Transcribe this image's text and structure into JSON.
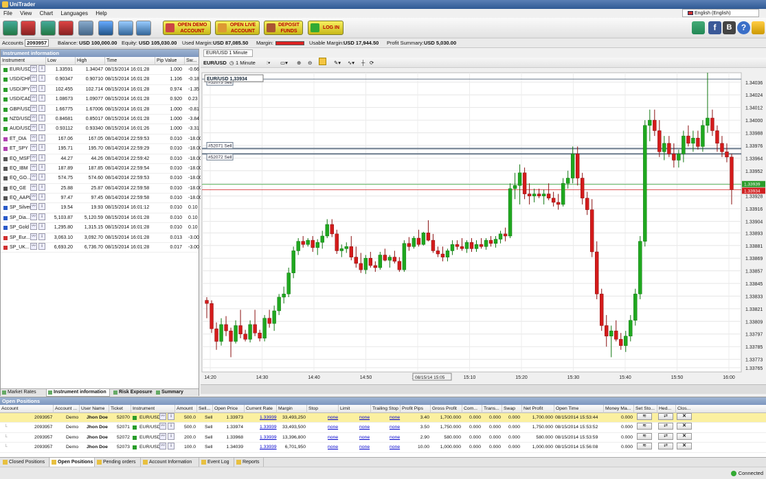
{
  "app": {
    "title": "UniTrader",
    "language": "English (English)"
  },
  "menu": [
    "File",
    "View",
    "Chart",
    "Languages",
    "Help"
  ],
  "toolbar": {
    "buttons": [
      {
        "icon": "buy-chart-icon"
      },
      {
        "icon": "sell-chart-icon"
      },
      {
        "icon": "buy-clock-icon"
      },
      {
        "icon": "sell-clock-icon"
      },
      {
        "icon": "cursor-icon"
      },
      {
        "icon": "currency-exchange-icon"
      },
      {
        "icon": "globe-icon"
      },
      {
        "icon": "settings-globe-icon"
      }
    ],
    "big_buttons": [
      {
        "line1": "OPEN DEMO",
        "line2": "ACCOUNT"
      },
      {
        "line1": "OPEN LIVE",
        "line2": "ACCOUNT"
      },
      {
        "line1": "DEPOSIT",
        "line2": "FUNDS"
      },
      {
        "line1": "LOG IN",
        "line2": ""
      }
    ],
    "right_icons": [
      "chart-icon",
      "facebook-icon",
      "blog-icon",
      "help-icon",
      "trader-icon"
    ]
  },
  "account": {
    "accounts_label": "Accounts",
    "account_id": "2093957",
    "balance_label": "Balance:",
    "balance": "USD 100,000.00",
    "equity_label": "Equity:",
    "equity": "USD 105,030.00",
    "used_margin_label": "Used Margin:",
    "used_margin": "USD 87,085.50",
    "margin_label": "Margin:",
    "usable_margin_label": "Usable Margin:",
    "usable_margin": "USD 17,944.50",
    "profit_label": "Profit Summary:",
    "profit": "USD 5,030.00"
  },
  "instrument_panel": {
    "title": "Instrument information",
    "columns": [
      "Instrument",
      "Low",
      "High",
      "Time",
      "Pip Value",
      "Sw..."
    ],
    "rows": [
      {
        "name": "EUR/USD",
        "low": "1.33591",
        "high": "1.34047",
        "time": "08/15/2014 16:01:28",
        "pip": "1.000",
        "sw": "-0.66",
        "color": "#2a9d2a"
      },
      {
        "name": "USD/CHF",
        "low": "0.90347",
        "high": "0.90710",
        "time": "08/15/2014 16:01:28",
        "pip": "1.106",
        "sw": "-0.18",
        "color": "#2a9d2a"
      },
      {
        "name": "USD/JPY",
        "low": "102.455",
        "high": "102.714",
        "time": "08/15/2014 16:01:28",
        "pip": "0.974",
        "sw": "-1.35",
        "color": "#2a9d2a"
      },
      {
        "name": "USD/CAD",
        "low": "1.08673",
        "high": "1.09077",
        "time": "08/15/2014 16:01:28",
        "pip": "0.920",
        "sw": "0.23",
        "color": "#2a9d2a"
      },
      {
        "name": "GBP/USD",
        "low": "1.66775",
        "high": "1.67006",
        "time": "08/15/2014 16:01:28",
        "pip": "1.000",
        "sw": "-0.81",
        "color": "#2a9d2a"
      },
      {
        "name": "NZD/USD",
        "low": "0.84681",
        "high": "0.85017",
        "time": "08/15/2014 16:01:28",
        "pip": "1.000",
        "sw": "-3.84",
        "color": "#2a9d2a"
      },
      {
        "name": "AUD/USD",
        "low": "0.93112",
        "high": "0.93340",
        "time": "08/15/2014 16:01:26",
        "pip": "1.000",
        "sw": "-3.31",
        "color": "#2a9d2a"
      },
      {
        "name": "ET_DIA",
        "low": "167.06",
        "high": "167.05",
        "time": "08/14/2014 22:59:53",
        "pip": "0.010",
        "sw": "-18.00",
        "color": "#b040b0"
      },
      {
        "name": "ET_SPY",
        "low": "195.71",
        "high": "195.70",
        "time": "08/14/2014 22:59:29",
        "pip": "0.010",
        "sw": "-18.00",
        "color": "#b040b0"
      },
      {
        "name": "EQ_MSFT",
        "low": "44.27",
        "high": "44.26",
        "time": "08/14/2014 22:59:42",
        "pip": "0.010",
        "sw": "-18.00",
        "color": "#555555"
      },
      {
        "name": "EQ_IBM",
        "low": "187.89",
        "high": "187.85",
        "time": "08/14/2014 22:59:54",
        "pip": "0.010",
        "sw": "-18.00",
        "color": "#555555"
      },
      {
        "name": "EQ_GO...",
        "low": "574.75",
        "high": "574.60",
        "time": "08/14/2014 22:59:53",
        "pip": "0.010",
        "sw": "-18.00",
        "color": "#555555"
      },
      {
        "name": "EQ_GE",
        "low": "25.88",
        "high": "25.87",
        "time": "08/14/2014 22:59:58",
        "pip": "0.010",
        "sw": "-18.00",
        "color": "#555555"
      },
      {
        "name": "EQ_AAPL",
        "low": "97.47",
        "high": "97.45",
        "time": "08/14/2014 22:59:58",
        "pip": "0.010",
        "sw": "-18.00",
        "color": "#555555"
      },
      {
        "name": "SP_Silver",
        "low": "19.54",
        "high": "19.93",
        "time": "08/15/2014 16:01:12",
        "pip": "0.010",
        "sw": "0.10",
        "color": "#2a5ac8"
      },
      {
        "name": "SP_Dia...",
        "low": "5,103.87",
        "high": "5,120.59",
        "time": "08/15/2014 16:01:28",
        "pip": "0.010",
        "sw": "0.10",
        "color": "#2a5ac8"
      },
      {
        "name": "SP_Gold",
        "low": "1,295.80",
        "high": "1,315.15",
        "time": "08/15/2014 16:01:28",
        "pip": "0.010",
        "sw": "0.10",
        "color": "#2a5ac8"
      },
      {
        "name": "SP_Eur...",
        "low": "3,063.10",
        "high": "3,092.70",
        "time": "08/15/2014 16:01:28",
        "pip": "0.013",
        "sw": "-3.00",
        "color": "#d03030"
      },
      {
        "name": "SP_UK...",
        "low": "6,693.20",
        "high": "6,736.70",
        "time": "08/15/2014 16:01:28",
        "pip": "0.017",
        "sw": "-3.00",
        "color": "#d03030"
      }
    ],
    "tabs": [
      "Market Rates",
      "Instrument information",
      "Risk Exposure",
      "Summary"
    ]
  },
  "chart": {
    "tab": "EUR/USD 1 Minute",
    "symbol": "EUR/USD",
    "timeframe": "1 Minute",
    "label": "EUR/USD  1,33934",
    "orders": [
      {
        "label": "#52073 Sell",
        "price": 1.34039
      },
      {
        "label": "#52071 Sell",
        "price": 1.33973
      },
      {
        "label": "#52072 Sell",
        "price": 1.33968
      }
    ],
    "bid": "1.33939",
    "ask": "1.33934",
    "bid_color": "#2a9d2a",
    "ask_color": "#d02020",
    "crosshair_time": "08/15/14 15:05",
    "y_labels": [
      "1.34036",
      "1.34024",
      "1.34012",
      "1.34000",
      "1.33988",
      "1.33976",
      "1.33964",
      "1.33952",
      "1.33940",
      "1.33928",
      "1.33916",
      "1.33904",
      "1.33893",
      "1.33881",
      "1.33869",
      "1.33857",
      "1.33845",
      "1.33833",
      "1.33821",
      "1.33809",
      "1.33797",
      "1.33785",
      "1.33773",
      "1.33765"
    ],
    "x_labels": [
      "14:20",
      "14:30",
      "14:40",
      "14:50",
      "15:00",
      "15:10",
      "15:20",
      "15:30",
      "15:40",
      "15:50",
      "16:00"
    ]
  },
  "chart_data": {
    "type": "candlestick",
    "title": "EUR/USD 1 Minute",
    "xlabel": "",
    "ylabel": "",
    "ylim": [
      1.33761,
      1.34045
    ],
    "x_range": [
      "14:20",
      "16:01"
    ],
    "candles": [
      [
        1.33829,
        1.33832,
        1.33812,
        1.33826
      ],
      [
        1.33826,
        1.33829,
        1.33798,
        1.33802
      ],
      [
        1.33802,
        1.33808,
        1.33782,
        1.3379
      ],
      [
        1.3379,
        1.33812,
        1.33786,
        1.33806
      ],
      [
        1.33806,
        1.33814,
        1.33795,
        1.338
      ],
      [
        1.338,
        1.33803,
        1.33775,
        1.3379
      ],
      [
        1.3379,
        1.3381,
        1.33788,
        1.33805
      ],
      [
        1.33805,
        1.3382,
        1.33793,
        1.33797
      ],
      [
        1.33797,
        1.33801,
        1.3379,
        1.33792
      ],
      [
        1.33792,
        1.3381,
        1.33789,
        1.33806
      ],
      [
        1.33806,
        1.3382,
        1.33795,
        1.33798
      ],
      [
        1.33798,
        1.33801,
        1.3379,
        1.33793
      ],
      [
        1.33793,
        1.33815,
        1.3379,
        1.33812
      ],
      [
        1.33812,
        1.3382,
        1.33803,
        1.33807
      ],
      [
        1.33807,
        1.33824,
        1.338,
        1.33819
      ],
      [
        1.33819,
        1.33835,
        1.33815,
        1.33832
      ],
      [
        1.33832,
        1.33842,
        1.33826,
        1.33835
      ],
      [
        1.33835,
        1.3386,
        1.33832,
        1.33855
      ],
      [
        1.33855,
        1.3388,
        1.3385,
        1.33876
      ],
      [
        1.33876,
        1.33888,
        1.33872,
        1.33885
      ],
      [
        1.33885,
        1.3389,
        1.33879,
        1.33882
      ],
      [
        1.33882,
        1.33888,
        1.3388,
        1.33886
      ],
      [
        1.33886,
        1.3389,
        1.33875,
        1.33879
      ],
      [
        1.33879,
        1.33887,
        1.33872,
        1.33884
      ],
      [
        1.33884,
        1.33895,
        1.33878,
        1.3389
      ],
      [
        1.3389,
        1.33906,
        1.33888,
        1.33901
      ],
      [
        1.33901,
        1.33906,
        1.33889,
        1.33892
      ],
      [
        1.33892,
        1.33896,
        1.33873,
        1.33876
      ],
      [
        1.33876,
        1.33882,
        1.3387,
        1.33878
      ],
      [
        1.33878,
        1.33884,
        1.33874,
        1.3388
      ],
      [
        1.3388,
        1.3389,
        1.33867,
        1.3387
      ],
      [
        1.3387,
        1.3388,
        1.3386,
        1.33864
      ],
      [
        1.33864,
        1.33874,
        1.33855,
        1.33858
      ],
      [
        1.33858,
        1.33872,
        1.33854,
        1.33869
      ],
      [
        1.33869,
        1.33875,
        1.3386,
        1.33862
      ],
      [
        1.33862,
        1.33866,
        1.33856,
        1.3386
      ],
      [
        1.3386,
        1.33875,
        1.33858,
        1.33872
      ],
      [
        1.33872,
        1.33878,
        1.33866,
        1.33867
      ],
      [
        1.33867,
        1.33872,
        1.3386,
        1.3387
      ],
      [
        1.3387,
        1.33876,
        1.33864,
        1.33866
      ],
      [
        1.33866,
        1.3387,
        1.33856,
        1.33858
      ],
      [
        1.33858,
        1.33886,
        1.33856,
        1.33883
      ],
      [
        1.33883,
        1.33889,
        1.33876,
        1.3388
      ],
      [
        1.3388,
        1.3389,
        1.33878,
        1.33888
      ],
      [
        1.33888,
        1.33896,
        1.3388,
        1.33882
      ],
      [
        1.33882,
        1.33894,
        1.33881,
        1.33893
      ],
      [
        1.33893,
        1.33905,
        1.33885,
        1.33886
      ],
      [
        1.33886,
        1.33892,
        1.33874,
        1.33876
      ],
      [
        1.33876,
        1.3388,
        1.3387,
        1.33873
      ],
      [
        1.33873,
        1.3388,
        1.33866,
        1.3387
      ],
      [
        1.3387,
        1.33878,
        1.33866,
        1.33876
      ],
      [
        1.33876,
        1.33886,
        1.33872,
        1.33882
      ],
      [
        1.33882,
        1.33886,
        1.33877,
        1.3388
      ],
      [
        1.3388,
        1.33888,
        1.33876,
        1.33878
      ],
      [
        1.33878,
        1.33886,
        1.33874,
        1.33884
      ],
      [
        1.33884,
        1.33888,
        1.33875,
        1.33878
      ],
      [
        1.33878,
        1.33886,
        1.33875,
        1.33882
      ],
      [
        1.33882,
        1.33888,
        1.33878,
        1.3388
      ],
      [
        1.3388,
        1.33888,
        1.33877,
        1.33886
      ],
      [
        1.33886,
        1.3389,
        1.3388,
        1.33883
      ],
      [
        1.33883,
        1.3389,
        1.33879,
        1.33887
      ],
      [
        1.33887,
        1.33895,
        1.33883,
        1.33892
      ],
      [
        1.33892,
        1.33898,
        1.33885,
        1.3389
      ],
      [
        1.3389,
        1.3394,
        1.33888,
        1.33935
      ],
      [
        1.33935,
        1.3395,
        1.33925,
        1.33938
      ],
      [
        1.33938,
        1.33958,
        1.3392,
        1.3395
      ],
      [
        1.3395,
        1.33955,
        1.33925,
        1.3393
      ],
      [
        1.3393,
        1.3394,
        1.3392,
        1.33928
      ],
      [
        1.33928,
        1.33935,
        1.33922,
        1.3393
      ],
      [
        1.3393,
        1.33935,
        1.33926,
        1.33928
      ],
      [
        1.33928,
        1.33934,
        1.3392,
        1.3393
      ],
      [
        1.3393,
        1.3394,
        1.33924,
        1.33926
      ],
      [
        1.33926,
        1.33932,
        1.33918,
        1.33922
      ],
      [
        1.33922,
        1.3393,
        1.33915,
        1.3392
      ],
      [
        1.3392,
        1.33945,
        1.33918,
        1.3394
      ],
      [
        1.3394,
        1.33952,
        1.33935,
        1.33945
      ],
      [
        1.33945,
        1.33975,
        1.3394,
        1.33968
      ],
      [
        1.33968,
        1.33975,
        1.33938,
        1.33945
      ],
      [
        1.33945,
        1.3395,
        1.3392,
        1.33926
      ],
      [
        1.33926,
        1.33932,
        1.3391,
        1.33915
      ],
      [
        1.33915,
        1.33925,
        1.3387,
        1.33875
      ],
      [
        1.33875,
        1.33885,
        1.3383,
        1.33835
      ],
      [
        1.33835,
        1.3384,
        1.338,
        1.33805
      ],
      [
        1.33805,
        1.33815,
        1.33785,
        1.33795
      ],
      [
        1.33795,
        1.33805,
        1.33775,
        1.338
      ],
      [
        1.338,
        1.3381,
        1.3379,
        1.33792
      ],
      [
        1.33792,
        1.33798,
        1.33782,
        1.33786
      ],
      [
        1.33786,
        1.338,
        1.3378,
        1.33795
      ],
      [
        1.33795,
        1.33815,
        1.3379,
        1.3381
      ],
      [
        1.3381,
        1.3384,
        1.33805,
        1.33835
      ],
      [
        1.33835,
        1.3389,
        1.3383,
        1.33885
      ],
      [
        1.33885,
        1.34,
        1.3388,
        1.33995
      ],
      [
        1.33995,
        1.3401,
        1.3398,
        1.34
      ],
      [
        1.34,
        1.3401,
        1.33985,
        1.3399
      ],
      [
        1.3399,
        1.34,
        1.33965,
        1.3397
      ],
      [
        1.3397,
        1.33985,
        1.33962,
        1.33978
      ],
      [
        1.33978,
        1.33985,
        1.33965,
        1.33968
      ],
      [
        1.33968,
        1.33978,
        1.33955,
        1.33962
      ],
      [
        1.33962,
        1.33972,
        1.33955,
        1.33968
      ],
      [
        1.33968,
        1.3399,
        1.3396,
        1.33985
      ],
      [
        1.33985,
        1.33995,
        1.33975,
        1.33978
      ],
      [
        1.33978,
        1.3399,
        1.3397,
        1.33983
      ],
      [
        1.33983,
        1.3399,
        1.33972,
        1.33975
      ],
      [
        1.33975,
        1.34,
        1.3397,
        1.33995
      ],
      [
        1.33995,
        1.34045,
        1.33988,
        1.34002
      ],
      [
        1.34002,
        1.3401,
        1.33985,
        1.3399
      ],
      [
        1.3399,
        1.33995,
        1.3397,
        1.33978
      ],
      [
        1.33978,
        1.33985,
        1.33965,
        1.3397
      ],
      [
        1.3397,
        1.33978,
        1.3396,
        1.33965
      ],
      [
        1.33965,
        1.33968,
        1.3392,
        1.33934
      ]
    ]
  },
  "open_positions": {
    "title": "Open Positions",
    "columns": [
      "Account",
      "Account ...",
      "User Name",
      "Ticket",
      "Instrument",
      "Amount",
      "Sell...",
      "Open Price",
      "Current Rate",
      "Margin",
      "Stop",
      "Limit",
      "Trailing Stop",
      "Profit Pips",
      "Gross Profit",
      "Com...",
      "Trans...",
      "Swap",
      "Net Profit",
      "Open Time",
      "Money Ma...",
      "Set Sto...",
      "Hed...",
      "Clos..."
    ],
    "rows": [
      {
        "account": "2093957",
        "type": "Demo",
        "user": "Jhon Doe",
        "ticket": "52070",
        "instrument": "EUR/USD",
        "amount": "500.0",
        "side": "Sell",
        "open": "1.33973",
        "rate": "1.33939",
        "margin": "33,493,250",
        "stop": "none",
        "limit": "none",
        "trailing": "none",
        "pips": "3.40",
        "gross": "1,700.000",
        "com": "0.000",
        "trans": "0.000",
        "swap": "0.000",
        "net": "1,700.000",
        "time": "08/15/2014 15:53:44",
        "money": "0.000"
      },
      {
        "account": "2093957",
        "type": "Demo",
        "user": "Jhon Doe",
        "ticket": "52071",
        "instrument": "EUR/USD",
        "amount": "500.0",
        "side": "Sell",
        "open": "1.33974",
        "rate": "1.33939",
        "margin": "33,493,500",
        "stop": "none",
        "limit": "none",
        "trailing": "none",
        "pips": "3.50",
        "gross": "1,750.000",
        "com": "0.000",
        "trans": "0.000",
        "swap": "0.000",
        "net": "1,750.000",
        "time": "08/15/2014 15:53:52",
        "money": "0.000"
      },
      {
        "account": "2093957",
        "type": "Demo",
        "user": "Jhon Doe",
        "ticket": "52072",
        "instrument": "EUR/USD",
        "amount": "200.0",
        "side": "Sell",
        "open": "1.33968",
        "rate": "1.33939",
        "margin": "13,396,800",
        "stop": "none",
        "limit": "none",
        "trailing": "none",
        "pips": "2.90",
        "gross": "580.000",
        "com": "0.000",
        "trans": "0.000",
        "swap": "0.000",
        "net": "580.000",
        "time": "08/15/2014 15:53:59",
        "money": "0.000"
      },
      {
        "account": "2093957",
        "type": "Demo",
        "user": "Jhon Doe",
        "ticket": "52073",
        "instrument": "EUR/USD",
        "amount": "100.0",
        "side": "Sell",
        "open": "1.34039",
        "rate": "1.33939",
        "margin": "6,701,950",
        "stop": "none",
        "limit": "none",
        "trailing": "none",
        "pips": "10.00",
        "gross": "1,000.000",
        "com": "0.000",
        "trans": "0.000",
        "swap": "0.000",
        "net": "1,000.000",
        "time": "08/15/2014 15:56:08",
        "money": "0.000"
      }
    ]
  },
  "bottom_tabs": [
    "Closed Positions",
    "Open Positions",
    "Pending orders",
    "Account Information",
    "Event Log",
    "Reports"
  ],
  "status": {
    "connection": "Connected"
  }
}
